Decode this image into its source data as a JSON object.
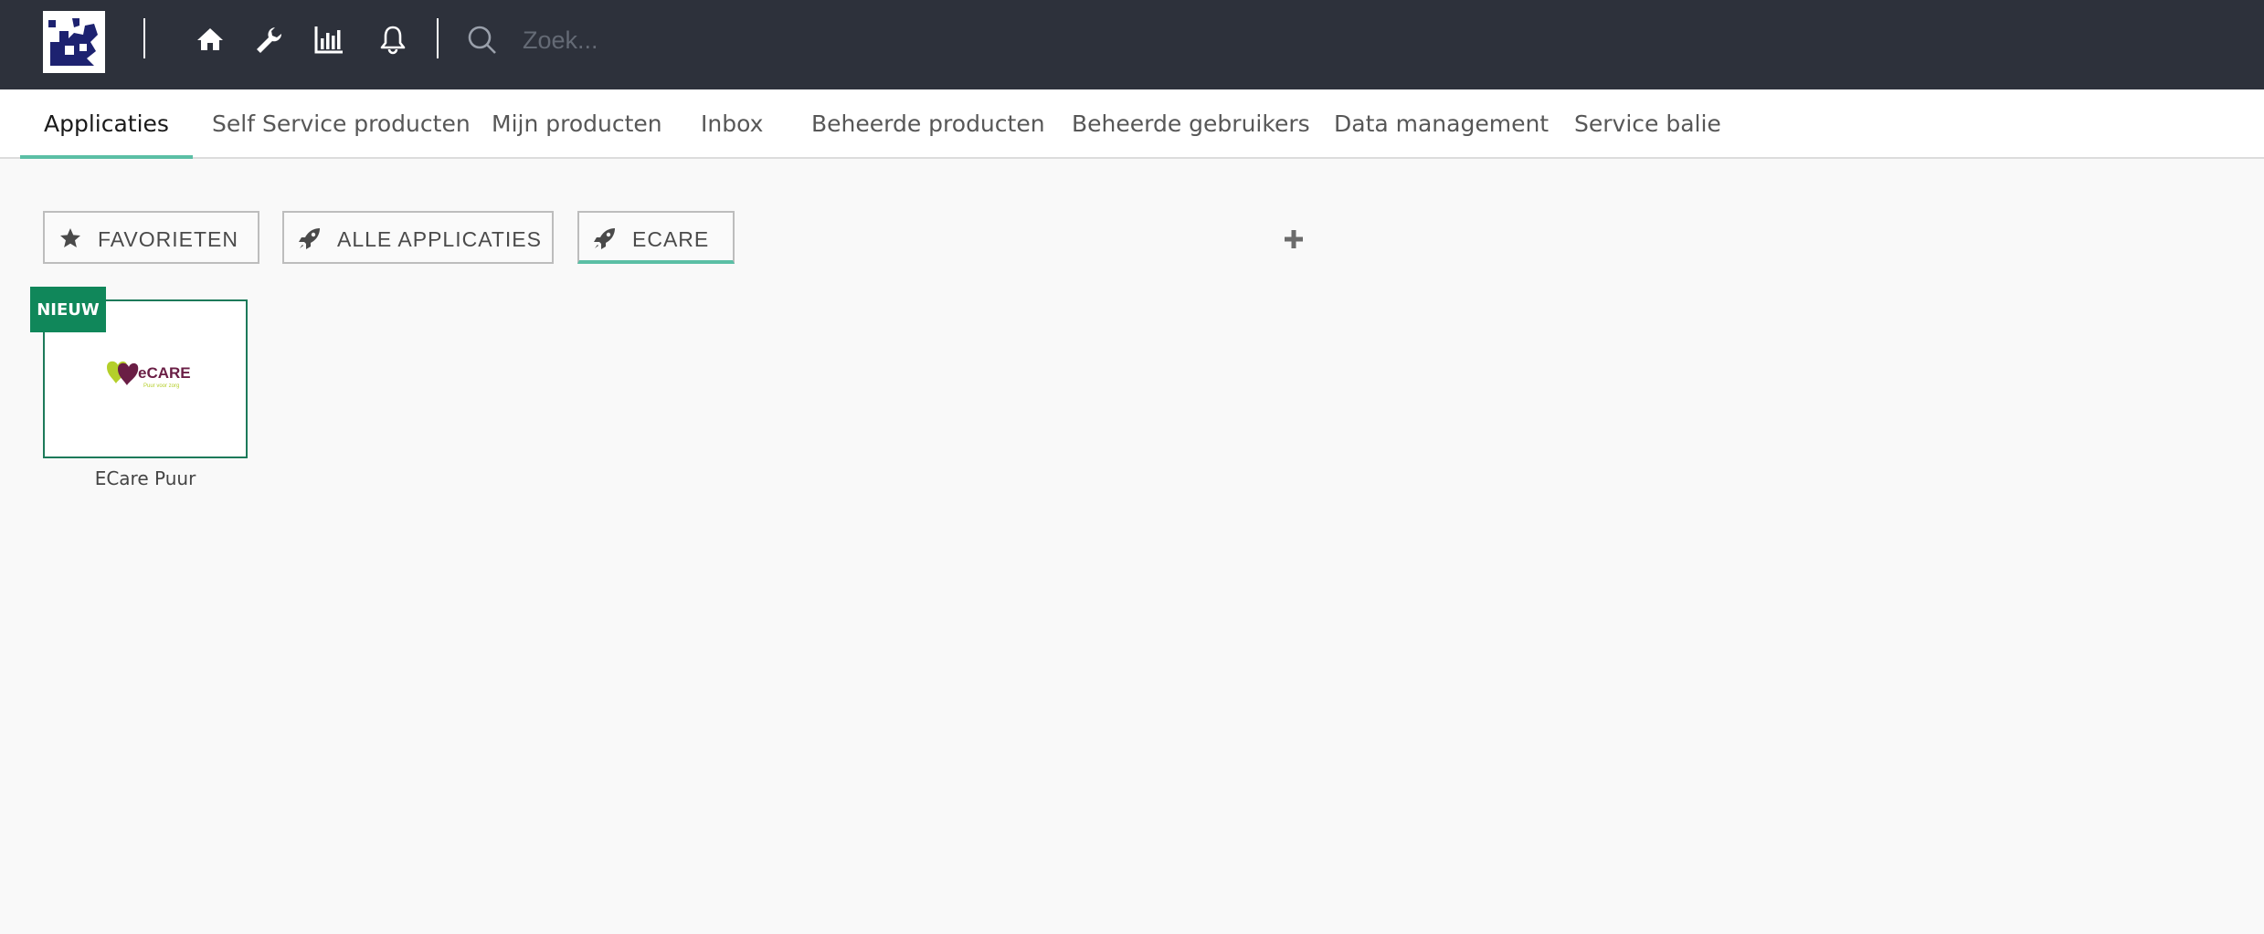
{
  "topbar": {
    "icons": [
      "home-icon",
      "wrench-icon",
      "bar-chart-icon",
      "bell-icon"
    ],
    "search": {
      "placeholder": "Zoek...",
      "value": ""
    }
  },
  "nav": {
    "tabs": [
      {
        "label": "Applicaties",
        "active": true
      },
      {
        "label": "Self Service producten"
      },
      {
        "label": "Mijn producten"
      },
      {
        "label": "Inbox"
      },
      {
        "label": "Beheerde producten"
      },
      {
        "label": "Beheerde gebruikers"
      },
      {
        "label": "Data management"
      },
      {
        "label": "Service balie"
      }
    ]
  },
  "categories": [
    {
      "label": "FAVORIETEN",
      "icon": "star-icon"
    },
    {
      "label": "ALLE APPLICATIES",
      "icon": "rocket-icon"
    },
    {
      "label": "ECARE",
      "icon": "rocket-icon",
      "active": true
    }
  ],
  "apps": [
    {
      "name": "ECare Puur",
      "badge": "NIEUW",
      "logo_text": "eCARE",
      "logo_tagline": "Puur voor zorg"
    }
  ],
  "colors": {
    "topbar": "#2d313b",
    "accent": "#5bbfa5",
    "badge": "#10875a"
  }
}
